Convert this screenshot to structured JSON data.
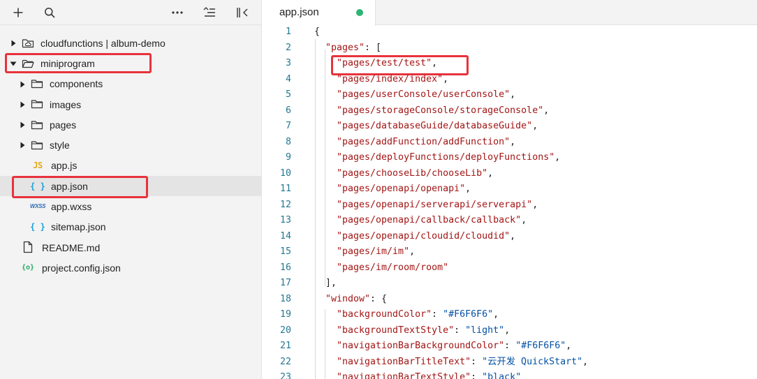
{
  "toolbar": {
    "icons": [
      "plus-icon",
      "search-icon",
      "more-icon",
      "collapse-list-icon",
      "panel-toggle-icon"
    ]
  },
  "file_tree": {
    "items": [
      {
        "label": "cloudfunctions | album-demo",
        "type": "cloud-folder",
        "depth": 0,
        "expanded": false
      },
      {
        "label": "miniprogram",
        "type": "folder",
        "depth": 0,
        "expanded": true
      },
      {
        "label": "components",
        "type": "folder",
        "depth": 1,
        "expanded": false
      },
      {
        "label": "images",
        "type": "folder",
        "depth": 1,
        "expanded": false
      },
      {
        "label": "pages",
        "type": "folder",
        "depth": 1,
        "expanded": false
      },
      {
        "label": "style",
        "type": "folder",
        "depth": 1,
        "expanded": false
      },
      {
        "label": "app.js",
        "type": "js",
        "depth": 1
      },
      {
        "label": "app.json",
        "type": "json",
        "depth": 1,
        "selected": true
      },
      {
        "label": "app.wxss",
        "type": "wxss",
        "depth": 1
      },
      {
        "label": "sitemap.json",
        "type": "json",
        "depth": 1
      },
      {
        "label": "README.md",
        "type": "file",
        "depth": 0
      },
      {
        "label": "project.config.json",
        "type": "config",
        "depth": 0
      }
    ],
    "glyphs": {
      "js": "JS",
      "json": "{ }",
      "wxss": "WXSS",
      "config": "{o}"
    }
  },
  "editor": {
    "tab": {
      "title": "app.json",
      "modified": true,
      "dot_color": "#2bb673"
    },
    "lines": [
      {
        "n": "1",
        "tokens": [
          {
            "t": "{",
            "c": "p"
          }
        ]
      },
      {
        "n": "2",
        "tokens": [
          {
            "t": "\"pages\"",
            "c": "k"
          },
          {
            "t": ": [",
            "c": "p"
          }
        ]
      },
      {
        "n": "3",
        "tokens": [
          {
            "t": "\"pages/test/test\"",
            "c": "k"
          },
          {
            "t": ",",
            "c": "p"
          }
        ]
      },
      {
        "n": "4",
        "tokens": [
          {
            "t": "\"pages/index/index\"",
            "c": "k"
          },
          {
            "t": ",",
            "c": "p"
          }
        ]
      },
      {
        "n": "5",
        "tokens": [
          {
            "t": "\"pages/userConsole/userConsole\"",
            "c": "k"
          },
          {
            "t": ",",
            "c": "p"
          }
        ]
      },
      {
        "n": "6",
        "tokens": [
          {
            "t": "\"pages/storageConsole/storageConsole\"",
            "c": "k"
          },
          {
            "t": ",",
            "c": "p"
          }
        ]
      },
      {
        "n": "7",
        "tokens": [
          {
            "t": "\"pages/databaseGuide/databaseGuide\"",
            "c": "k"
          },
          {
            "t": ",",
            "c": "p"
          }
        ]
      },
      {
        "n": "8",
        "tokens": [
          {
            "t": "\"pages/addFunction/addFunction\"",
            "c": "k"
          },
          {
            "t": ",",
            "c": "p"
          }
        ]
      },
      {
        "n": "9",
        "tokens": [
          {
            "t": "\"pages/deployFunctions/deployFunctions\"",
            "c": "k"
          },
          {
            "t": ",",
            "c": "p"
          }
        ]
      },
      {
        "n": "10",
        "tokens": [
          {
            "t": "\"pages/chooseLib/chooseLib\"",
            "c": "k"
          },
          {
            "t": ",",
            "c": "p"
          }
        ]
      },
      {
        "n": "11",
        "tokens": [
          {
            "t": "\"pages/openapi/openapi\"",
            "c": "k"
          },
          {
            "t": ",",
            "c": "p"
          }
        ]
      },
      {
        "n": "12",
        "tokens": [
          {
            "t": "\"pages/openapi/serverapi/serverapi\"",
            "c": "k"
          },
          {
            "t": ",",
            "c": "p"
          }
        ]
      },
      {
        "n": "13",
        "tokens": [
          {
            "t": "\"pages/openapi/callback/callback\"",
            "c": "k"
          },
          {
            "t": ",",
            "c": "p"
          }
        ]
      },
      {
        "n": "14",
        "tokens": [
          {
            "t": "\"pages/openapi/cloudid/cloudid\"",
            "c": "k"
          },
          {
            "t": ",",
            "c": "p"
          }
        ]
      },
      {
        "n": "15",
        "tokens": [
          {
            "t": "\"pages/im/im\"",
            "c": "k"
          },
          {
            "t": ",",
            "c": "p"
          }
        ]
      },
      {
        "n": "16",
        "tokens": [
          {
            "t": "\"pages/im/room/room\"",
            "c": "k"
          }
        ]
      },
      {
        "n": "17",
        "tokens": [
          {
            "t": "],",
            "c": "p"
          }
        ]
      },
      {
        "n": "18",
        "tokens": [
          {
            "t": "\"window\"",
            "c": "k"
          },
          {
            "t": ": {",
            "c": "p"
          }
        ]
      },
      {
        "n": "19",
        "tokens": [
          {
            "t": "\"backgroundColor\"",
            "c": "k"
          },
          {
            "t": ": ",
            "c": "p"
          },
          {
            "t": "\"#F6F6F6\"",
            "c": "s"
          },
          {
            "t": ",",
            "c": "p"
          }
        ]
      },
      {
        "n": "20",
        "tokens": [
          {
            "t": "\"backgroundTextStyle\"",
            "c": "k"
          },
          {
            "t": ": ",
            "c": "p"
          },
          {
            "t": "\"light\"",
            "c": "s"
          },
          {
            "t": ",",
            "c": "p"
          }
        ]
      },
      {
        "n": "21",
        "tokens": [
          {
            "t": "\"navigationBarBackgroundColor\"",
            "c": "k"
          },
          {
            "t": ": ",
            "c": "p"
          },
          {
            "t": "\"#F6F6F6\"",
            "c": "s"
          },
          {
            "t": ",",
            "c": "p"
          }
        ]
      },
      {
        "n": "22",
        "tokens": [
          {
            "t": "\"navigationBarTitleText\"",
            "c": "k"
          },
          {
            "t": ": ",
            "c": "p"
          },
          {
            "t": "\"云开发 QuickStart\"",
            "c": "s"
          },
          {
            "t": ",",
            "c": "p"
          }
        ]
      },
      {
        "n": "23",
        "tokens": [
          {
            "t": "\"navigationBarTextStyle\"",
            "c": "k"
          },
          {
            "t": ": ",
            "c": "p"
          },
          {
            "t": "\"black\"",
            "c": "s"
          }
        ]
      }
    ]
  },
  "colors": {
    "highlight": "#e8323c",
    "line_number": "#237893",
    "json_key": "#a31515",
    "json_string": "#0451a5",
    "selected_row": "#e4e4e4"
  }
}
